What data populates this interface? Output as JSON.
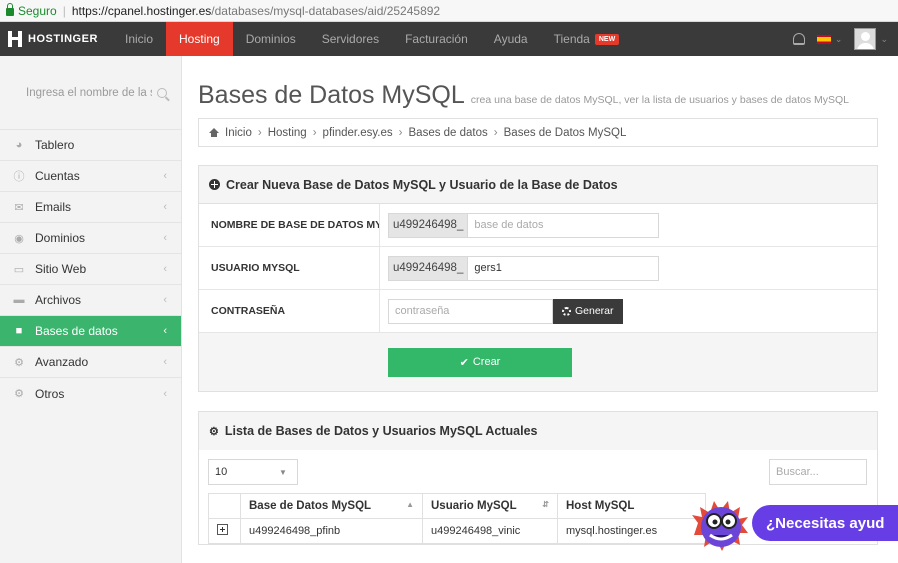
{
  "browser": {
    "secure_label": "Seguro",
    "url_host": "https://cpanel.hostinger.es",
    "url_path": "/databases/mysql-databases/aid/25245892"
  },
  "topnav": {
    "brand": "HOSTINGER",
    "items": [
      {
        "label": "Inicio",
        "active": false
      },
      {
        "label": "Hosting",
        "active": true
      },
      {
        "label": "Dominios",
        "active": false
      },
      {
        "label": "Servidores",
        "active": false
      },
      {
        "label": "Facturación",
        "active": false
      },
      {
        "label": "Ayuda",
        "active": false
      },
      {
        "label": "Tienda",
        "active": false
      }
    ],
    "store_badge": "NEW",
    "accent": "#e53a2b"
  },
  "sidebar": {
    "search_placeholder": "Ingresa el nombre de la se",
    "items": [
      {
        "label": "Tablero",
        "icon": "dashboard-icon",
        "arrow": false
      },
      {
        "label": "Cuentas",
        "icon": "info-icon",
        "arrow": true
      },
      {
        "label": "Emails",
        "icon": "envelope-icon",
        "arrow": true
      },
      {
        "label": "Dominios",
        "icon": "globe-icon",
        "arrow": true
      },
      {
        "label": "Sitio Web",
        "icon": "monitor-icon",
        "arrow": true
      },
      {
        "label": "Archivos",
        "icon": "folder-icon",
        "arrow": true
      },
      {
        "label": "Bases de datos",
        "icon": "database-icon",
        "arrow": true,
        "active": true
      },
      {
        "label": "Avanzado",
        "icon": "gears-icon",
        "arrow": true
      },
      {
        "label": "Otros",
        "icon": "gear-icon",
        "arrow": true
      }
    ],
    "active_color": "#3bb56d"
  },
  "page": {
    "title": "Bases de Datos MySQL",
    "subtitle": "crea una base de datos MySQL, ver la lista de usuarios y bases de datos MySQL",
    "breadcrumb": [
      "Inicio",
      "Hosting",
      "pfinder.esy.es",
      "Bases de datos",
      "Bases de Datos MySQL"
    ]
  },
  "create_panel": {
    "heading": "Crear Nueva Base de Datos MySQL y Usuario de la Base de Datos",
    "db_name_label": "NOMBRE DE BASE DE DATOS MYSQL",
    "db_prefix": "u499246498_",
    "db_placeholder": "base de datos",
    "user_label": "USUARIO MYSQL",
    "user_prefix": "u499246498_",
    "user_value": "gers1",
    "password_label": "CONTRASEÑA",
    "password_placeholder": "contraseña",
    "generate_label": "Generar",
    "create_label": "Crear",
    "create_color": "#33b86a"
  },
  "list_panel": {
    "heading": "Lista de Bases de Datos y Usuarios MySQL Actuales",
    "page_length": "10",
    "search_placeholder": "Buscar...",
    "columns": [
      "Base de Datos MySQL",
      "Usuario MySQL",
      "Host MySQL"
    ],
    "rows": [
      [
        "u499246498_pfinb",
        "u499246498_vinic",
        "mysql.hostinger.es"
      ]
    ]
  },
  "chat": {
    "label": "¿Necesitas ayud",
    "color": "#673de6"
  }
}
